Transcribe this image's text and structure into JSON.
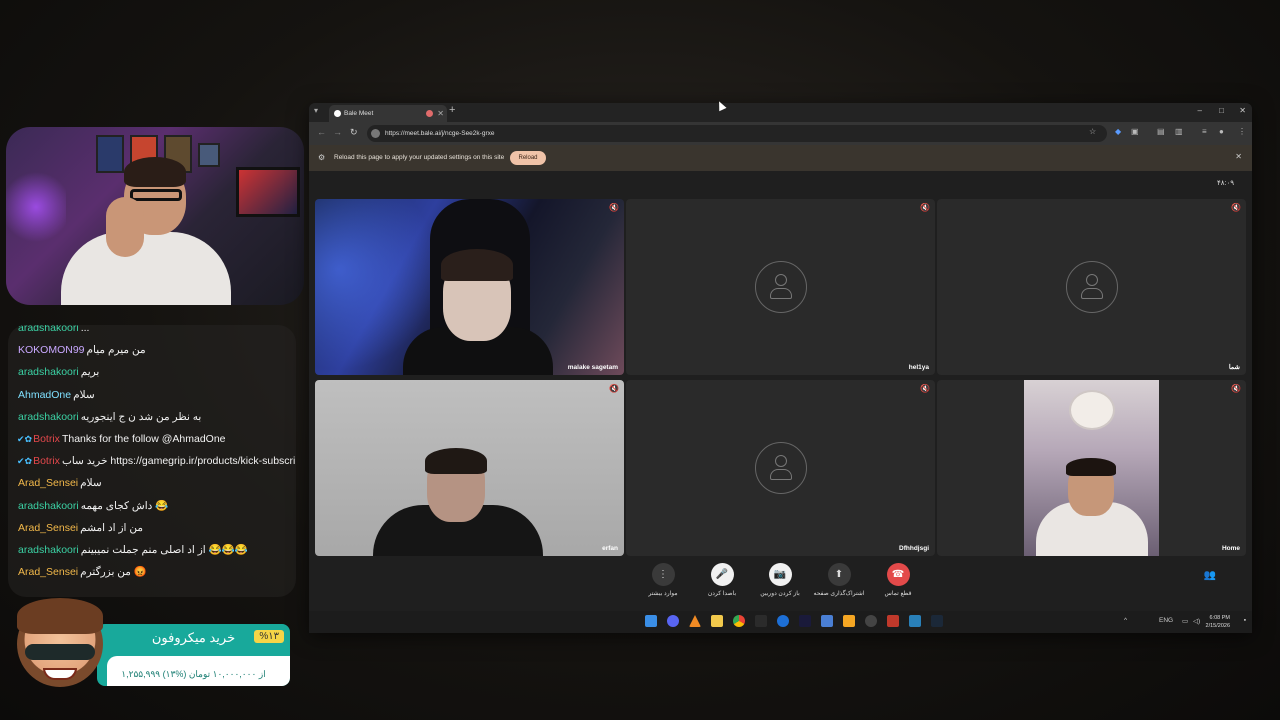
{
  "browser": {
    "tab_title": "Bale Meet",
    "new_tab": "+",
    "url": "https://meet.bale.ai/j/ncge-See2k-grxe",
    "window_controls": [
      "–",
      "□",
      "✕"
    ]
  },
  "infobar": {
    "message": "Reload this page to apply your updated settings on this site",
    "reload_label": "Reload",
    "close": "✕"
  },
  "meet": {
    "timer": "۴۸:۰۹",
    "tiles": [
      {
        "name": "malake sagetam",
        "has_video": true
      },
      {
        "name": "hel1ya",
        "has_video": false
      },
      {
        "name": "شما",
        "has_video": false
      },
      {
        "name": "erfan",
        "has_video": true
      },
      {
        "name": "Dfhhdjsgi",
        "has_video": false
      },
      {
        "name": "Home",
        "has_video": true
      }
    ],
    "controls": [
      {
        "label": "موارد بیشتر",
        "icon": "more-vert-icon",
        "glyph": "⋮",
        "style": "dark"
      },
      {
        "label": "باصدا کردن",
        "icon": "mic-off-icon",
        "glyph": "🎤",
        "style": "white"
      },
      {
        "label": "باز کردن دوربین",
        "icon": "camera-off-icon",
        "glyph": "📷",
        "style": "white"
      },
      {
        "label": "اشتراک‌گذاری صفحه",
        "icon": "share-screen-icon",
        "glyph": "⬆",
        "style": "dark"
      },
      {
        "label": "قطع تماس",
        "icon": "hang-up-icon",
        "glyph": "☎",
        "style": "red"
      }
    ]
  },
  "chat": {
    "messages": [
      {
        "user": "aradshakoori",
        "user_color": "#3bd1a4",
        "text": "...",
        "badges": ""
      },
      {
        "user": "KOKOMON99",
        "user_color": "#c9a8ff",
        "text": "من میرم میام",
        "badges": ""
      },
      {
        "user": "aradshakoori",
        "user_color": "#3bd1a4",
        "text": "بریم",
        "badges": ""
      },
      {
        "user": "AhmadOne",
        "user_color": "#7fe0ff",
        "text": "سلام",
        "badges": ""
      },
      {
        "user": "aradshakoori",
        "user_color": "#3bd1a4",
        "text": "به نظر من شد ن ج اینجوریه",
        "badges": ""
      },
      {
        "user": "Botrix",
        "user_color": "#e2474b",
        "text": "Thanks for the follow @AhmadOne",
        "badges": "✔✿"
      },
      {
        "user": "Botrix",
        "user_color": "#e2474b",
        "text": "خرید ساب https://gamegrip.ir/products/kick-subscription/",
        "badges": "✔✿"
      },
      {
        "user": "Arad_Sensei",
        "user_color": "#f3b94a",
        "text": "سلام",
        "badges": ""
      },
      {
        "user": "aradshakoori",
        "user_color": "#3bd1a4",
        "text": "داش کجای مهمه 😂",
        "badges": ""
      },
      {
        "user": "Arad_Sensei",
        "user_color": "#f3b94a",
        "text": "من از اد امشم",
        "badges": ""
      },
      {
        "user": "aradshakoori",
        "user_color": "#3bd1a4",
        "text": "از اد اصلی منم جملت نمیبینم 😂😂😂",
        "badges": ""
      },
      {
        "user": "Arad_Sensei",
        "user_color": "#f3b94a",
        "text": "من بزرگترم 😡",
        "badges": ""
      }
    ]
  },
  "promo": {
    "title": "خرید میکروفون",
    "discount": "%۱۳",
    "price": "۱,۲۵۵,۹۹۹ از ۱۰,۰۰۰,۰۰۰ تومان (%۱۳)"
  },
  "taskbar": {
    "language": "ENG",
    "time": "6:08 PM",
    "date": "2/15/2026"
  },
  "colors": {
    "accent_teal": "#18a99b",
    "hangup_red": "#e34a4a",
    "reload_peach": "#f0c3a8"
  }
}
